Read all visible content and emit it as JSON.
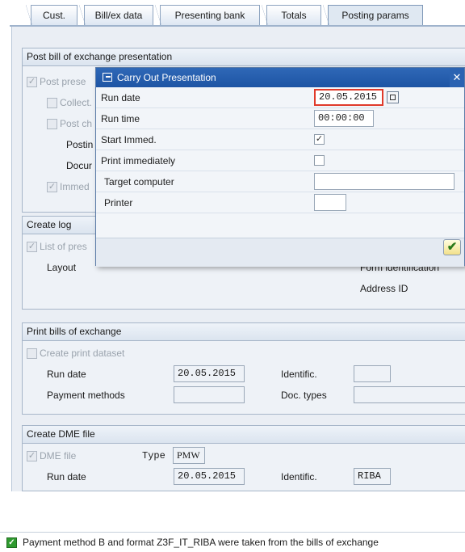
{
  "tabs": [
    {
      "label": "Cust."
    },
    {
      "label": "Bill/ex data"
    },
    {
      "label": "Presenting bank"
    },
    {
      "label": "Totals"
    },
    {
      "label": "Posting params"
    }
  ],
  "post_group": {
    "title": "Post bill of exchange presentation",
    "post_presentation": "Post prese",
    "collect": "Collect.",
    "post_ch": "Post ch",
    "posting": "Postin",
    "document": "Docur",
    "immed": "Immed"
  },
  "log_group": {
    "title": "Create log",
    "list_of_pres": "List of pres",
    "layout_label": "Layout",
    "form_identification": "Form identification",
    "address_id": "Address ID"
  },
  "print_group": {
    "title": "Print bills of exchange",
    "create_print_dataset": "Create print dataset",
    "run_date_label": "Run date",
    "run_date_value": "20.05.2015",
    "identific_label": "Identific.",
    "identific_value": "",
    "payment_methods_label": "Payment methods",
    "payment_methods_value": "",
    "doc_types_label": "Doc. types",
    "doc_types_value": ""
  },
  "dme_group": {
    "title": "Create DME file",
    "dme_file": "DME file",
    "type_label": "Type",
    "type_value": "PMW",
    "run_date_label": "Run date",
    "run_date_value": "20.05.2015",
    "identific_label": "Identific.",
    "identific_value": "RIBA"
  },
  "dialog": {
    "title": "Carry Out Presentation",
    "close": "✕",
    "run_date_label": "Run date",
    "run_date_value": "20.05.2015",
    "run_time_label": "Run time",
    "run_time_value": "00:00:00",
    "start_immed_label": "Start Immed.",
    "start_immed_checked": true,
    "print_immediately_label": "Print immediately",
    "print_immediately_checked": false,
    "target_computer_label": "Target computer",
    "target_computer_value": "",
    "printer_label": "Printer",
    "printer_value": "",
    "ok_icon": "checkmark-icon"
  },
  "status": {
    "icon": "success-icon",
    "text": "Payment method B and format Z3F_IT_RIBA were taken from the bills of exchange"
  },
  "colors": {
    "dialog_title_bg": "#1d54a4",
    "status_ok": "#2f9a2f"
  }
}
